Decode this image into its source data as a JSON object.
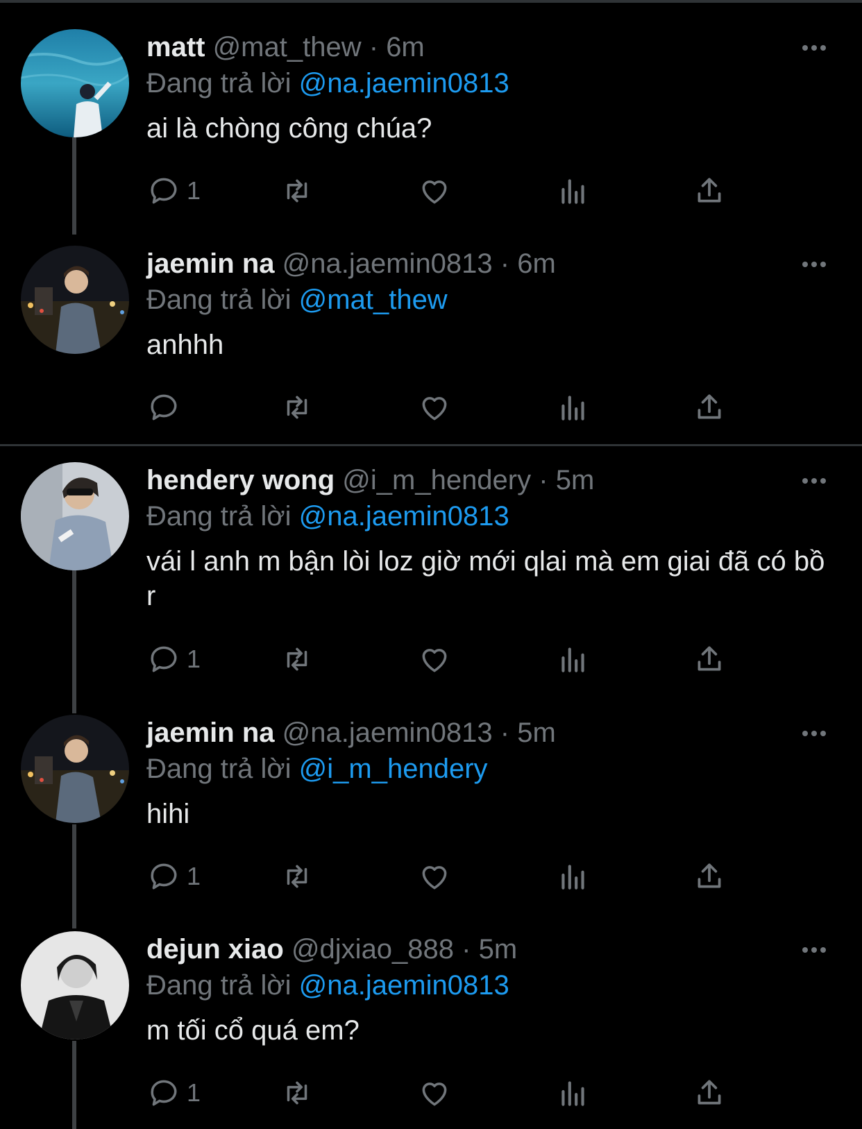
{
  "replying_prefix": "Đang trả lời",
  "tweets": [
    {
      "name": "matt",
      "handle": "@mat_thew",
      "dot": "·",
      "time": "6m",
      "replying_to": "@na.jaemin0813",
      "text": "ai là chòng công chúa?",
      "reply_count": "1"
    },
    {
      "name": "jaemin na",
      "handle": "@na.jaemin0813",
      "dot": "·",
      "time": "6m",
      "replying_to": "@mat_thew",
      "text": "anhhh",
      "reply_count": ""
    },
    {
      "name": "hendery wong",
      "handle": "@i_m_hendery",
      "dot": "·",
      "time": "5m",
      "replying_to": "@na.jaemin0813",
      "text": "vái l anh m bận lòi loz giờ mới qlai mà em giai đã có bồ r",
      "reply_count": "1"
    },
    {
      "name": "jaemin na",
      "handle": "@na.jaemin0813",
      "dot": "·",
      "time": "5m",
      "replying_to": "@i_m_hendery",
      "text": "hihi",
      "reply_count": "1"
    },
    {
      "name": "dejun xiao",
      "handle": "@djxiao_888",
      "dot": "·",
      "time": "5m",
      "replying_to": "@na.jaemin0813",
      "text": "m tối cổ quá em?",
      "reply_count": "1"
    }
  ],
  "icons": {
    "reply": "reply-icon",
    "retweet": "retweet-icon",
    "like": "heart-icon",
    "views": "analytics-icon",
    "share": "share-icon",
    "more": "more-dots-icon"
  },
  "colors": {
    "background": "#000000",
    "text": "#e7e9ea",
    "secondary": "#71767b",
    "mention": "#1d9bf0"
  }
}
